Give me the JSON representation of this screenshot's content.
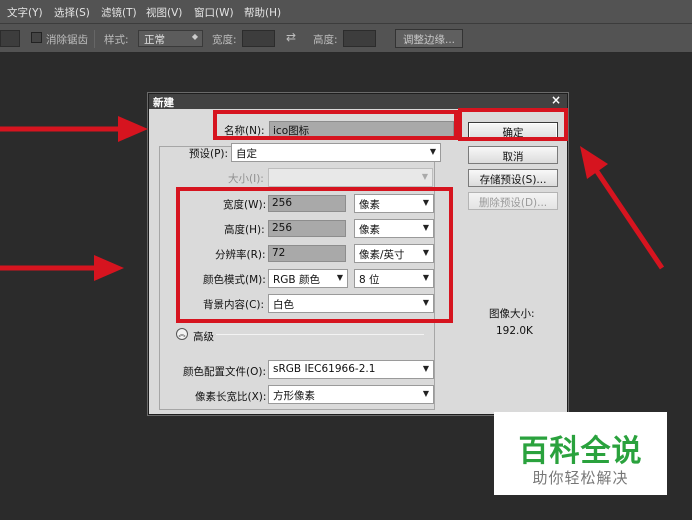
{
  "menubar": {
    "items": [
      "文字(Y)",
      "选择(S)",
      "滤镜(T)",
      "视图(V)",
      "窗口(W)",
      "帮助(H)"
    ]
  },
  "options_bar": {
    "antialias_label": "消除锯齿",
    "style_label": "样式:",
    "style_value": "正常",
    "width_label": "宽度:",
    "height_label": "高度:",
    "refine_edge_label": "调整边缘..."
  },
  "dialog": {
    "title": "新建",
    "close_glyph": "×",
    "name_label": "名称(N):",
    "name_value": "ico图标",
    "preset_label": "预设(P):",
    "preset_value": "自定",
    "size_label": "大小(I):",
    "size_value": "",
    "width_label": "宽度(W):",
    "width_value": "256",
    "width_unit": "像素",
    "height_label": "高度(H):",
    "height_value": "256",
    "height_unit": "像素",
    "resolution_label": "分辨率(R):",
    "resolution_value": "72",
    "resolution_unit": "像素/英寸",
    "color_mode_label": "颜色模式(M):",
    "color_mode_value": "RGB 颜色",
    "bit_depth_value": "8 位",
    "background_label": "背景内容(C):",
    "background_value": "白色",
    "advanced_label": "高级",
    "color_profile_label": "颜色配置文件(O):",
    "color_profile_value": "sRGB IEC61966-2.1",
    "pixel_aspect_label": "像素长宽比(X):",
    "pixel_aspect_value": "方形像素",
    "ok_label": "确定",
    "cancel_label": "取消",
    "save_preset_label": "存储预设(S)...",
    "delete_preset_label": "删除预设(D)...",
    "image_size_label": "图像大小:",
    "image_size_value": "192.0K"
  },
  "watermark": {
    "title": "百科全说",
    "subtitle": "助你轻松解决"
  },
  "colors": {
    "annotation_red": "#d6141f",
    "watermark_green": "#2aa23d"
  }
}
